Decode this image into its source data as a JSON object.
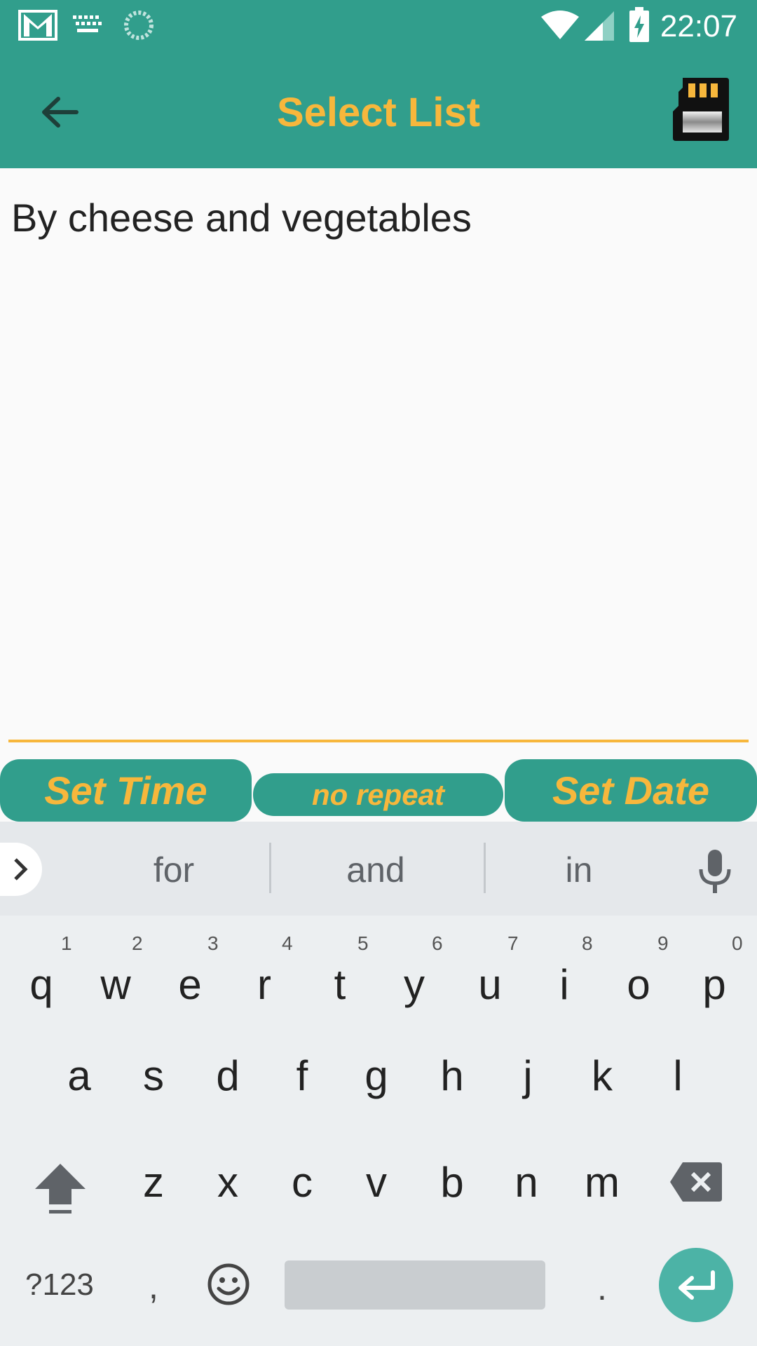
{
  "status_bar": {
    "time": "22:07",
    "icons": [
      "gmail-icon",
      "keyboard-icon",
      "sync-icon",
      "wifi-icon",
      "signal-icon",
      "battery-charging-icon"
    ]
  },
  "app_bar": {
    "title": "Select List",
    "back_icon": "arrow-back-icon",
    "action_icon": "sd-card-icon"
  },
  "content": {
    "note_text": "By cheese and vegetables"
  },
  "actions": {
    "set_time": "Set Time",
    "repeat": "no repeat",
    "set_date": "Set Date"
  },
  "colors": {
    "primary": "#319e8c",
    "accent": "#f7b73c"
  },
  "keyboard": {
    "suggestions": [
      "for",
      "and",
      "in"
    ],
    "row1": [
      "q",
      "w",
      "e",
      "r",
      "t",
      "y",
      "u",
      "i",
      "o",
      "p"
    ],
    "row1_hints": [
      "1",
      "2",
      "3",
      "4",
      "5",
      "6",
      "7",
      "8",
      "9",
      "0"
    ],
    "row2": [
      "a",
      "s",
      "d",
      "f",
      "g",
      "h",
      "j",
      "k",
      "l"
    ],
    "row3": [
      "z",
      "x",
      "c",
      "v",
      "b",
      "n",
      "m"
    ],
    "symbols_key": "?123",
    "comma_key": ",",
    "period_key": "."
  }
}
